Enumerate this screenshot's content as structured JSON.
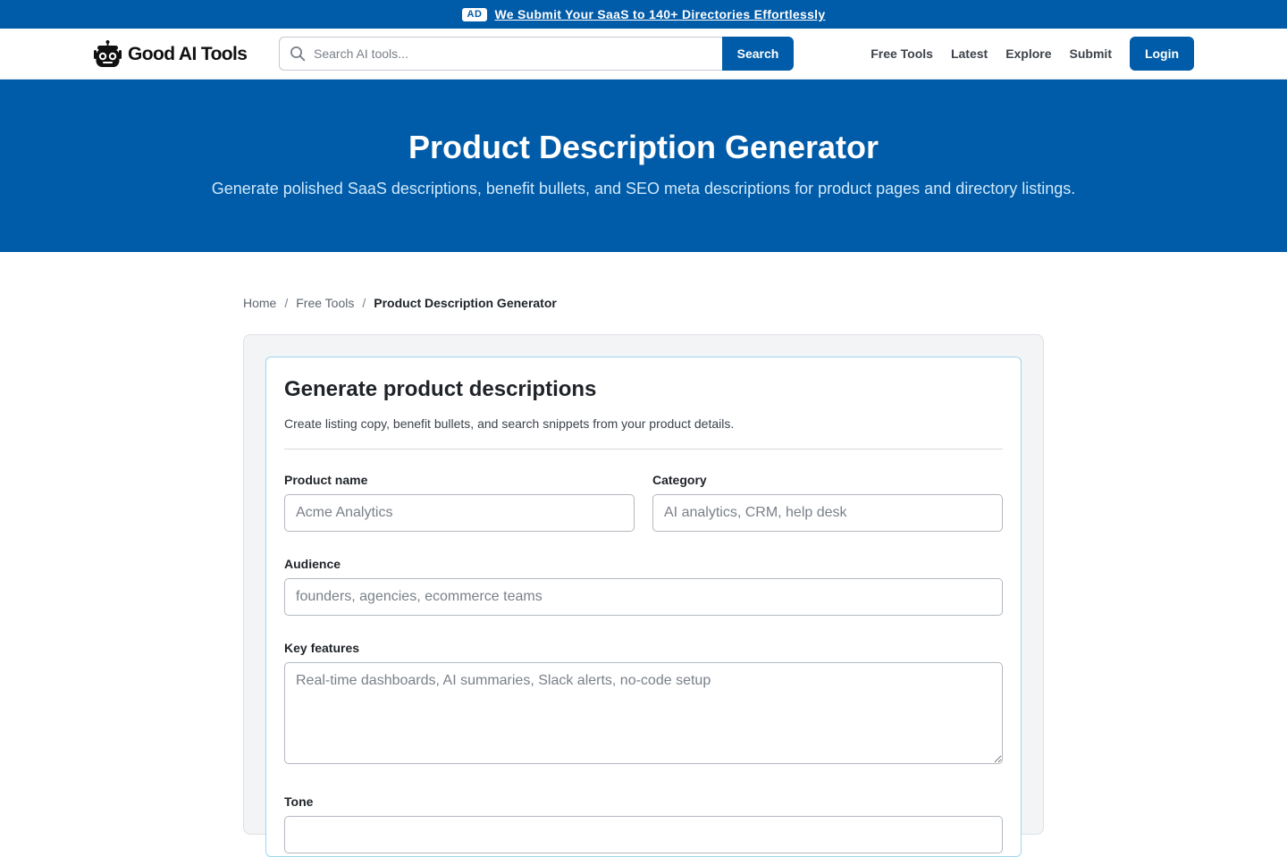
{
  "ad": {
    "badge": "AD",
    "text": "We Submit Your SaaS to 140+ Directories Effortlessly"
  },
  "header": {
    "logo_text": "Good AI Tools",
    "search_placeholder": "Search AI tools...",
    "search_button": "Search",
    "nav": [
      "Free Tools",
      "Latest",
      "Explore",
      "Submit"
    ],
    "login": "Login"
  },
  "hero": {
    "title": "Product Description Generator",
    "subtitle": "Generate polished SaaS descriptions, benefit bullets, and SEO meta descriptions for product pages and directory listings."
  },
  "breadcrumb": {
    "home": "Home",
    "parent": "Free Tools",
    "current": "Product Description Generator",
    "separator": "/"
  },
  "form": {
    "title": "Generate product descriptions",
    "subtitle": "Create listing copy, benefit bullets, and search snippets from your product details.",
    "product_name": {
      "label": "Product name",
      "placeholder": "Acme Analytics"
    },
    "category": {
      "label": "Category",
      "placeholder": "AI analytics, CRM, help desk"
    },
    "audience": {
      "label": "Audience",
      "placeholder": "founders, agencies, ecommerce teams"
    },
    "key_features": {
      "label": "Key features",
      "placeholder": "Real-time dashboards, AI summaries, Slack alerts, no-code setup"
    },
    "tone": {
      "label": "Tone"
    }
  },
  "colors": {
    "brand": "#005ba8",
    "hero_subtitle": "#cfe9fb",
    "card_border": "#9dd6ef"
  }
}
